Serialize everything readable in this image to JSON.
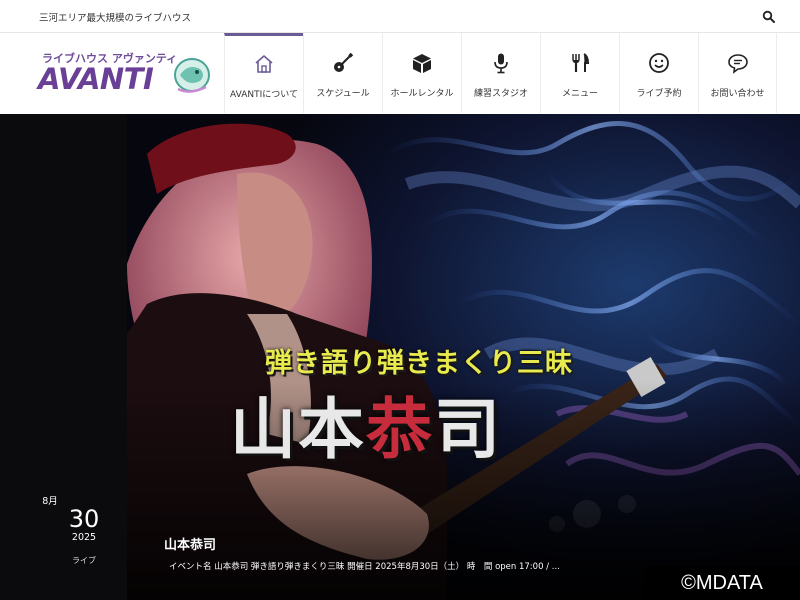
{
  "topbar": {
    "tagline": "三河エリア最大規模のライブハウス"
  },
  "logo": {
    "subtitle": "ライブハウス アヴァンティ",
    "name": "AVANTI"
  },
  "nav": {
    "items": [
      {
        "label": "AVANTIについて",
        "icon": "home-icon",
        "active": true
      },
      {
        "label": "スケジュール",
        "icon": "guitar-icon"
      },
      {
        "label": "ホールレンタル",
        "icon": "box-icon"
      },
      {
        "label": "練習スタジオ",
        "icon": "microphone-icon"
      },
      {
        "label": "メニュー",
        "icon": "fork-knife-icon"
      },
      {
        "label": "ライブ予約",
        "icon": "smiley-icon"
      },
      {
        "label": "お問い合わせ",
        "icon": "chat-bubble-icon"
      }
    ]
  },
  "hero": {
    "poster_subtitle": "弾き語り弾きまくり三昧",
    "poster_name_a": "山本",
    "poster_name_b": "恭",
    "poster_name_c": "司",
    "date": {
      "month": "8月",
      "day": "30",
      "year": "2025",
      "category": "ライブ"
    },
    "event_title": "山本恭司",
    "event_excerpt": "イベント名 山本恭司 弾き語り弾きまくり三昧 開催日 2025年8月30日（土） 時　間 open 17:00 / ...",
    "copyright": "©MDATA"
  },
  "colors": {
    "accent": "#6b5b95",
    "poster_yellow": "#e8ea4d",
    "poster_red": "#c72c3c"
  }
}
